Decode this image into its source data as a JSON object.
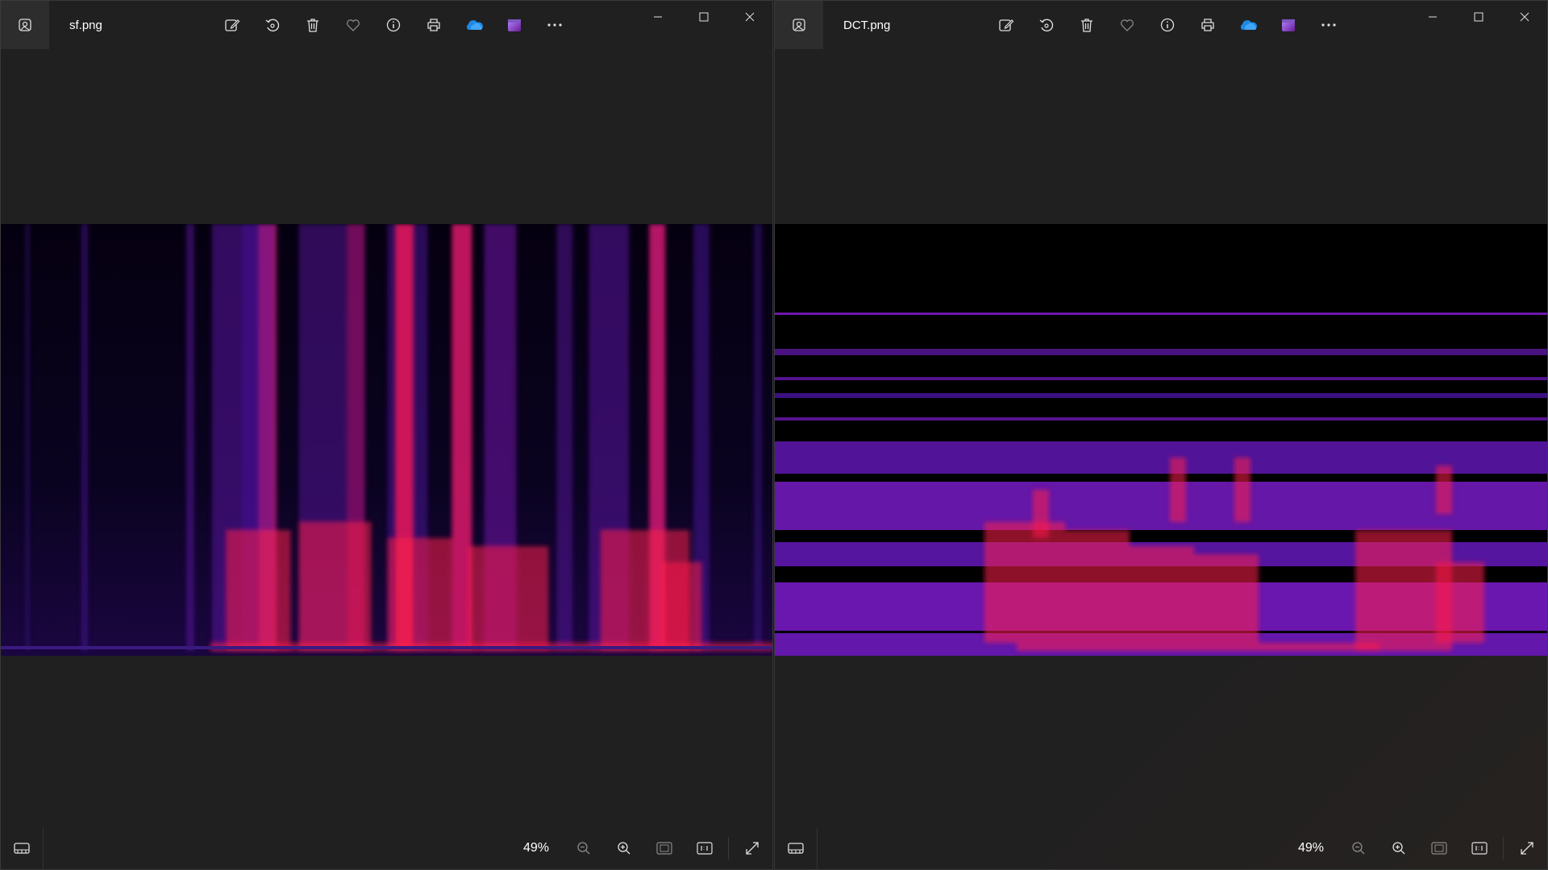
{
  "windows": [
    {
      "id": "left",
      "filename": "sf.png",
      "zoom": "49%",
      "image": "spectrogram-original"
    },
    {
      "id": "right",
      "filename": "DCT.png",
      "zoom": "49%",
      "image": "spectrogram-dct"
    }
  ],
  "toolbar": {
    "icons": [
      "edit-image-icon",
      "rotate-icon",
      "delete-icon",
      "favorite-icon",
      "info-icon",
      "print-icon",
      "onedrive-icon",
      "clipchamp-icon",
      "more-options-icon"
    ]
  },
  "window_controls": [
    "minimize-icon",
    "maximize-icon",
    "close-icon"
  ],
  "statusbar": {
    "icons": [
      "filmstrip-icon",
      "zoom-out-icon",
      "zoom-in-icon",
      "fit-window-icon",
      "actual-size-icon",
      "fullscreen-icon"
    ]
  },
  "colors": {
    "window_bg": "#202020",
    "spectrogram_low": "#000000",
    "spectrogram_mid": "#4a148c",
    "spectrogram_high": "#ff1744"
  }
}
